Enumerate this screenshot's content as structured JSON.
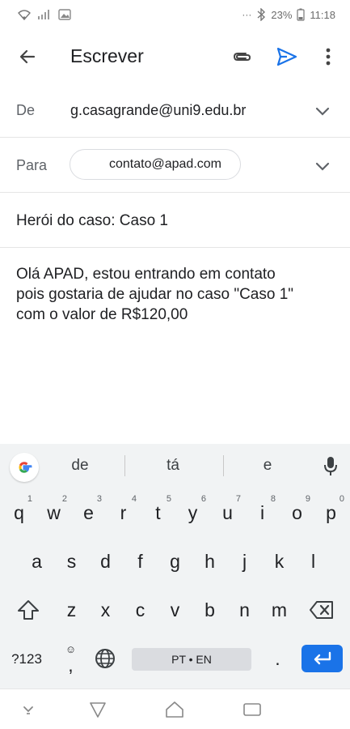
{
  "status": {
    "battery": "23%",
    "time": "11:18",
    "more": "···"
  },
  "appbar": {
    "title": "Escrever",
    "back_icon": "arrow-back-icon",
    "attach_icon": "attachment-icon",
    "send_icon": "send-icon",
    "more_icon": "more-vert-icon"
  },
  "compose": {
    "from_label": "De",
    "from_value": "g.casagrande@uni9.edu.br",
    "to_label": "Para",
    "to_value": "contato@apad.com",
    "subject": "Herói do caso: Caso 1",
    "body_lines": [
      "Olá APAD, estou entrando em contato",
      "pois gostaria de ajudar no caso \"Caso 1\"",
      "com o valor de R$120,00"
    ]
  },
  "keyboard": {
    "suggestions": [
      "de",
      "tá",
      "e"
    ],
    "row1": [
      {
        "k": "q",
        "h": "1"
      },
      {
        "k": "w",
        "h": "2"
      },
      {
        "k": "e",
        "h": "3"
      },
      {
        "k": "r",
        "h": "4"
      },
      {
        "k": "t",
        "h": "5"
      },
      {
        "k": "y",
        "h": "6"
      },
      {
        "k": "u",
        "h": "7"
      },
      {
        "k": "i",
        "h": "8"
      },
      {
        "k": "o",
        "h": "9"
      },
      {
        "k": "p",
        "h": "0"
      }
    ],
    "row2": [
      "a",
      "s",
      "d",
      "f",
      "g",
      "h",
      "j",
      "k",
      "l"
    ],
    "row3": [
      "z",
      "x",
      "c",
      "v",
      "b",
      "n",
      "m"
    ],
    "symbols_label": "?123",
    "comma": ",",
    "period": ".",
    "space_label": "PT • EN"
  },
  "colors": {
    "accent": "#1a73e8",
    "keyboard_bg": "#f1f3f4"
  }
}
